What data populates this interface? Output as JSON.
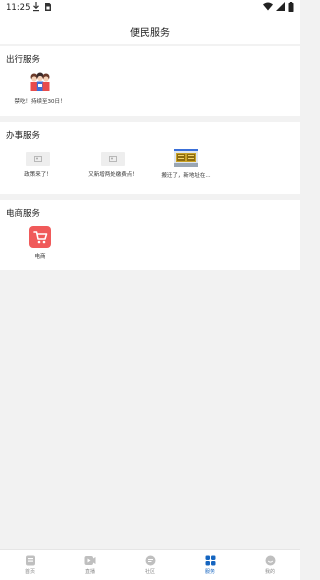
{
  "status_bar": {
    "time": "11:25"
  },
  "header": {
    "title": "便民服务"
  },
  "sections": [
    {
      "title": "出行服务",
      "items": [
        {
          "label": "禁吃！持续至30日！",
          "icon": "cartoon-people-icon"
        }
      ]
    },
    {
      "title": "办事服务",
      "items": [
        {
          "label": "政策来了！",
          "icon": "image-placeholder-icon"
        },
        {
          "label": "又新增两处缴费点！",
          "icon": "image-placeholder-icon"
        },
        {
          "label": "搬迁了，新地址在...",
          "icon": "building-sign-icon"
        }
      ]
    },
    {
      "title": "电商服务",
      "items": [
        {
          "label": "电商",
          "icon": "shopping-cart-icon"
        }
      ]
    }
  ],
  "tabs": [
    {
      "label": "首页",
      "icon": "home-doc-icon",
      "active": false
    },
    {
      "label": "直播",
      "icon": "video-play-icon",
      "active": false
    },
    {
      "label": "社区",
      "icon": "message-icon",
      "active": false
    },
    {
      "label": "服务",
      "icon": "grid-icon",
      "active": true
    },
    {
      "label": "我的",
      "icon": "smile-face-icon",
      "active": false
    }
  ],
  "colors": {
    "accent": "#1565c0",
    "cart_red": "#f05a5a"
  }
}
